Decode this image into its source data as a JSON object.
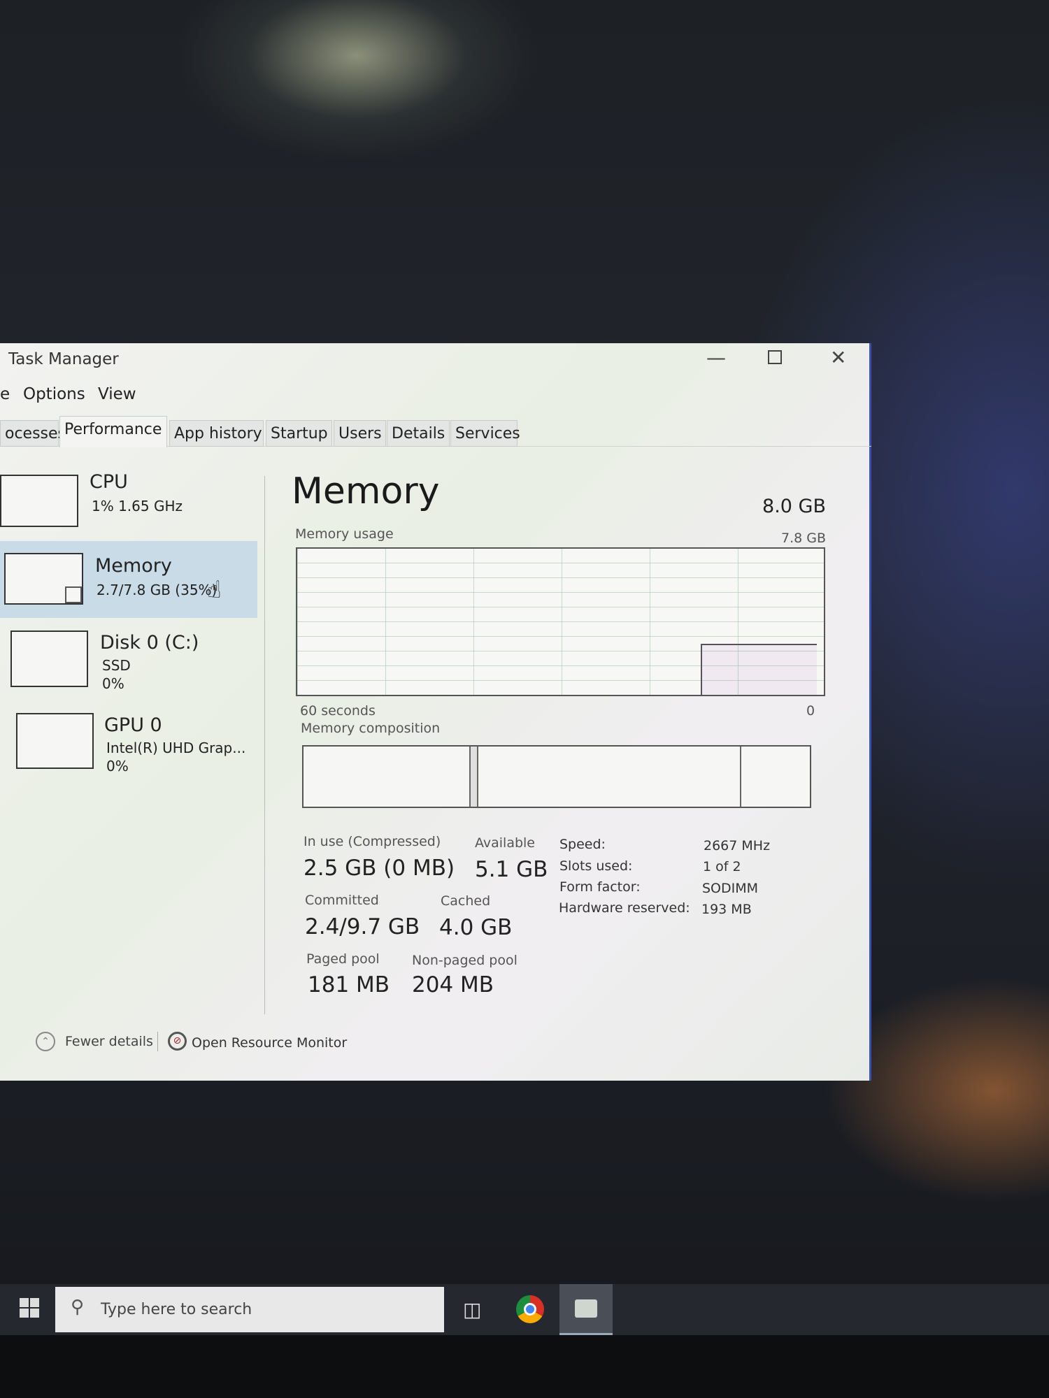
{
  "window": {
    "title": "Task Manager",
    "minimize_icon": "minimize-icon",
    "maximize_icon": "maximize-icon",
    "close_icon": "close-icon"
  },
  "menu": {
    "file_partial": "e",
    "options": "Options",
    "view": "View"
  },
  "tabs": [
    {
      "label": "ocesses"
    },
    {
      "label": "Performance",
      "active": true
    },
    {
      "label": "App history"
    },
    {
      "label": "Startup"
    },
    {
      "label": "Users"
    },
    {
      "label": "Details"
    },
    {
      "label": "Services"
    }
  ],
  "sidebar": {
    "items": [
      {
        "name": "CPU",
        "line1": "1% 1.65 GHz"
      },
      {
        "name": "Memory",
        "line1": "2.7/7.8 GB (35%)",
        "selected": true
      },
      {
        "name": "Disk 0 (C:)",
        "line1": "SSD",
        "line2": "0%"
      },
      {
        "name": "GPU 0",
        "line1": "Intel(R) UHD Grap...",
        "line2": "0%"
      }
    ]
  },
  "main": {
    "title": "Memory",
    "total": "8.0 GB",
    "usage_label": "Memory usage",
    "usage_max": "7.8 GB",
    "time_label": "60 seconds",
    "usage_min": "0",
    "usage_level_percent": 35,
    "composition_label": "Memory composition",
    "composition_fractions": {
      "in_use": 0.33,
      "modified": 0.015,
      "standby": 0.52,
      "free": 0.135
    },
    "stats": {
      "in_use_label": "In use (Compressed)",
      "in_use": "2.5 GB (0 MB)",
      "available_label": "Available",
      "available": "5.1 GB",
      "committed_label": "Committed",
      "committed": "2.4/9.7 GB",
      "cached_label": "Cached",
      "cached": "4.0 GB",
      "paged_label": "Paged pool",
      "paged": "181 MB",
      "nonpaged_label": "Non-paged pool",
      "nonpaged": "204 MB"
    },
    "specs": [
      {
        "label": "Speed:",
        "value": "2667 MHz"
      },
      {
        "label": "Slots used:",
        "value": "1 of 2"
      },
      {
        "label": "Form factor:",
        "value": "SODIMM"
      },
      {
        "label": "Hardware reserved:",
        "value": "193 MB"
      }
    ]
  },
  "footer": {
    "fewer_details": "Fewer details",
    "resource_monitor": "Open Resource Monitor"
  },
  "taskbar": {
    "search_placeholder": "Type here to search"
  },
  "colors": {
    "selected_bg": "#c9dbe6",
    "window_border": "#3a4fb0",
    "taskbar": "#25282e"
  }
}
